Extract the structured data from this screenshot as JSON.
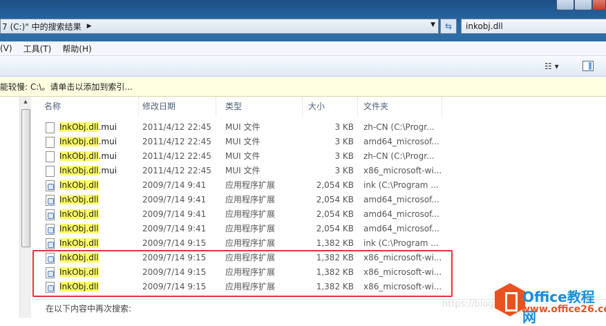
{
  "address": {
    "path": "7 (C:)\" 中的搜索结果",
    "search_value": "inkobj.dll"
  },
  "menu": [
    "(V)",
    "工具(T)",
    "帮助(H)"
  ],
  "infobar": "能较慢: C:\\。请单击以添加到索引...",
  "columns": [
    "名称",
    "修改日期",
    "类型",
    "大小",
    "文件夹"
  ],
  "rows": [
    {
      "hl": "InkObj.dll",
      "ext": ".mui",
      "date": "2011/4/12 22:45",
      "type": "MUI 文件",
      "size": "3 KB",
      "folder": "zh-CN (C:\\Progr...",
      "icon": "file"
    },
    {
      "hl": "InkObj.dll",
      "ext": ".mui",
      "date": "2011/4/12 22:45",
      "type": "MUI 文件",
      "size": "3 KB",
      "folder": "amd64_microsof...",
      "icon": "file"
    },
    {
      "hl": "InkObj.dll",
      "ext": ".mui",
      "date": "2011/4/12 22:45",
      "type": "MUI 文件",
      "size": "3 KB",
      "folder": "zh-CN (C:\\Progr...",
      "icon": "file"
    },
    {
      "hl": "InkObj.dll",
      "ext": ".mui",
      "date": "2011/4/12 22:45",
      "type": "MUI 文件",
      "size": "3 KB",
      "folder": "x86_microsoft-wi...",
      "icon": "file"
    },
    {
      "hl": "InkObj.dll",
      "ext": "",
      "date": "2009/7/14 9:41",
      "type": "应用程序扩展",
      "size": "2,054 KB",
      "folder": "ink (C:\\Program ...",
      "icon": "dll"
    },
    {
      "hl": "InkObj.dll",
      "ext": "",
      "date": "2009/7/14 9:41",
      "type": "应用程序扩展",
      "size": "2,054 KB",
      "folder": "amd64_microsof...",
      "icon": "dll"
    },
    {
      "hl": "InkObj.dll",
      "ext": "",
      "date": "2009/7/14 9:41",
      "type": "应用程序扩展",
      "size": "2,054 KB",
      "folder": "amd64_microsof...",
      "icon": "dll"
    },
    {
      "hl": "InkObj.dll",
      "ext": "",
      "date": "2009/7/14 9:41",
      "type": "应用程序扩展",
      "size": "2,054 KB",
      "folder": "amd64_microsof...",
      "icon": "dll"
    },
    {
      "hl": "InkObj.dll",
      "ext": "",
      "date": "2009/7/14 9:15",
      "type": "应用程序扩展",
      "size": "1,382 KB",
      "folder": "ink (C:\\Program ...",
      "icon": "dll"
    },
    {
      "hl": "InkObj.dll",
      "ext": "",
      "date": "2009/7/14 9:15",
      "type": "应用程序扩展",
      "size": "1,382 KB",
      "folder": "x86_microsoft-wi...",
      "icon": "dll"
    },
    {
      "hl": "InkObj.dll",
      "ext": "",
      "date": "2009/7/14 9:15",
      "type": "应用程序扩展",
      "size": "1,382 KB",
      "folder": "x86_microsoft-wi...",
      "icon": "dll"
    },
    {
      "hl": "InkObj.dll",
      "ext": "",
      "date": "2009/7/14 9:15",
      "type": "应用程序扩展",
      "size": "1,382 KB",
      "folder": "x86_microsoft-wi...",
      "icon": "dll"
    }
  ],
  "footer": "在以下内容中再次搜索:",
  "watermark": {
    "url": "https://blog",
    "brand": "Office教程网",
    "site": "www.office26.com"
  }
}
